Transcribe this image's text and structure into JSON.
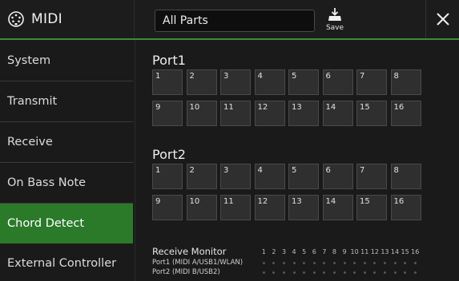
{
  "header": {
    "title": "MIDI",
    "parts_select": "All Parts",
    "save_label": "Save"
  },
  "sidebar": {
    "items": [
      {
        "label": "System",
        "active": false
      },
      {
        "label": "Transmit",
        "active": false
      },
      {
        "label": "Receive",
        "active": false
      },
      {
        "label": "On Bass Note",
        "active": false
      },
      {
        "label": "Chord Detect",
        "active": true
      },
      {
        "label": "External Controller",
        "active": false
      }
    ]
  },
  "main": {
    "port1": {
      "title": "Port1",
      "channels": [
        "1",
        "2",
        "3",
        "4",
        "5",
        "6",
        "7",
        "8",
        "9",
        "10",
        "11",
        "12",
        "13",
        "14",
        "15",
        "16"
      ]
    },
    "port2": {
      "title": "Port2",
      "channels": [
        "1",
        "2",
        "3",
        "4",
        "5",
        "6",
        "7",
        "8",
        "9",
        "10",
        "11",
        "12",
        "13",
        "14",
        "15",
        "16"
      ]
    },
    "receive_monitor": {
      "title": "Receive Monitor",
      "channels": [
        "1",
        "2",
        "3",
        "4",
        "5",
        "6",
        "7",
        "8",
        "9",
        "10",
        "11",
        "12",
        "13",
        "14",
        "15",
        "16"
      ],
      "rows": [
        {
          "label": "Port1 (MIDI A/USB1/WLAN)"
        },
        {
          "label": "Port2 (MIDI B/USB2)"
        }
      ]
    }
  },
  "colors": {
    "accent": "#2b7a2a",
    "header_rule": "#3f8a3b",
    "cell_bg": "#2f2f2f"
  }
}
